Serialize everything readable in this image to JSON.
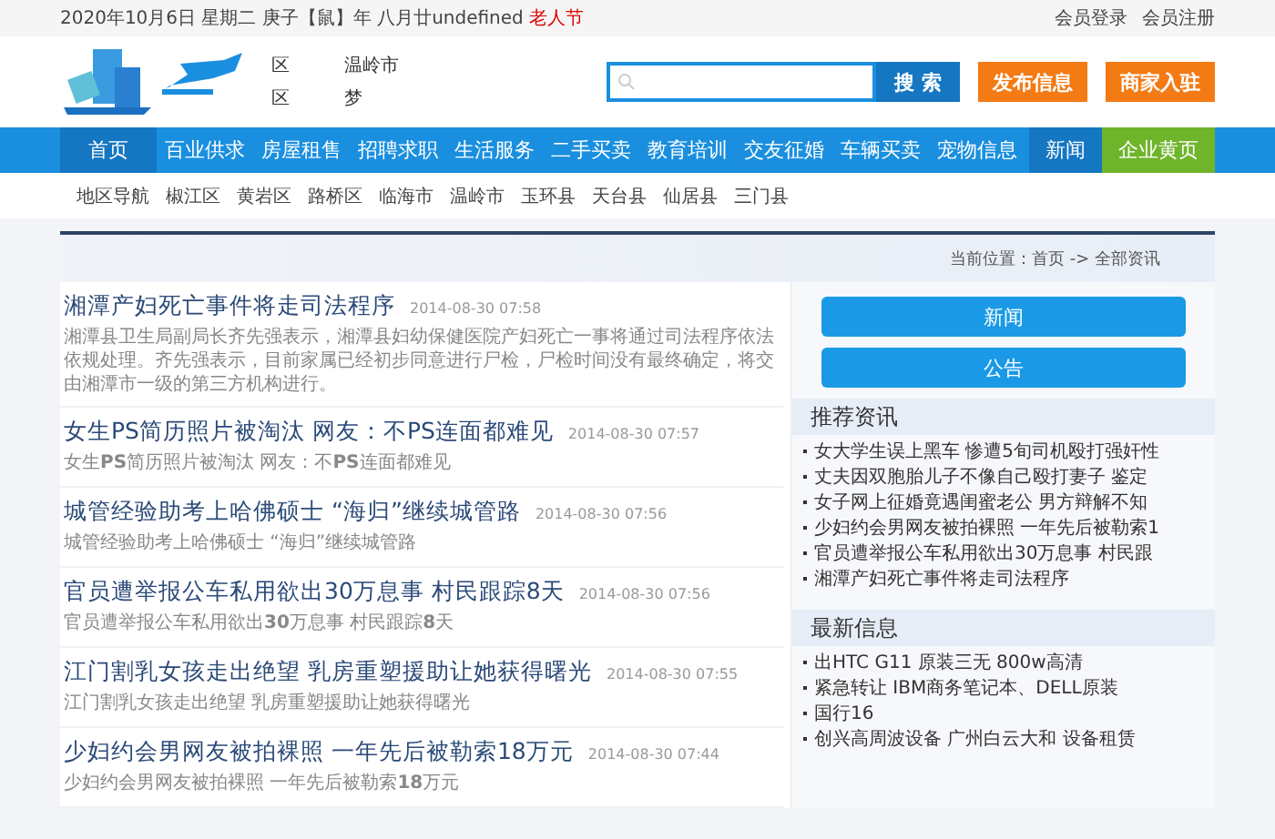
{
  "top_bar": {
    "date_text": "2020年10月6日 星期二 庚子【鼠】年 八月廿undefined",
    "festival": "老人节",
    "links": [
      "会员登录",
      "会员注册"
    ]
  },
  "header": {
    "logo_texts": [
      "区",
      "温岭市",
      "区",
      "梦"
    ],
    "search": {
      "button": "搜 索"
    },
    "actions": [
      "发布信息",
      "商家入驻"
    ]
  },
  "nav": {
    "items": [
      {
        "label": "首页",
        "selected": true
      },
      {
        "label": "百业供求",
        "selected": false
      },
      {
        "label": "房屋租售",
        "selected": false
      },
      {
        "label": "招聘求职",
        "selected": false
      },
      {
        "label": "生活服务",
        "selected": false
      },
      {
        "label": "二手买卖",
        "selected": false
      },
      {
        "label": "教育培训",
        "selected": false
      },
      {
        "label": "交友征婚",
        "selected": false
      },
      {
        "label": "车辆买卖",
        "selected": false
      },
      {
        "label": "宠物信息",
        "selected": false
      }
    ],
    "right_items": [
      {
        "label": "新闻",
        "kind": "news"
      },
      {
        "label": "企业黄页",
        "kind": "yellow"
      }
    ]
  },
  "region_nav": [
    "地区导航",
    "椒江区",
    "黄岩区",
    "路桥区",
    "临海市",
    "温岭市",
    "玉环县",
    "天台县",
    "仙居县",
    "三门县"
  ],
  "breadcrumb": "当前位置：首页 -> 全部资讯",
  "articles": [
    {
      "title": "湘潭产妇死亡事件将走司法程序",
      "time": "2014-08-30 07:58",
      "summary": "湘潭县卫生局副局长齐先强表示，湘潭县妇幼保健医院产妇死亡一事将通过司法程序依法依规处理。齐先强表示，目前家属已经初步同意进行尸检，尸检时间没有最终确定，将交由湘潭市一级的第三方机构进行。"
    },
    {
      "title": "女生PS简历照片被淘汰 网友：不PS连面都难见",
      "time": "2014-08-30 07:57",
      "summary": "女生**PS**简历照片被淘汰 网友：不**PS**连面都难见"
    },
    {
      "title": "城管经验助考上哈佛硕士 “海归”继续城管路",
      "time": "2014-08-30 07:56",
      "summary": "城管经验助考上哈佛硕士 “海归”继续城管路"
    },
    {
      "title": "官员遭举报公车私用欲出30万息事 村民跟踪8天",
      "time": "2014-08-30 07:56",
      "summary": "官员遭举报公车私用欲出**30**万息事 村民跟踪**8**天"
    },
    {
      "title": "江门割乳女孩走出绝望 乳房重塑援助让她获得曙光",
      "time": "2014-08-30 07:55",
      "summary": "江门割乳女孩走出绝望 乳房重塑援助让她获得曙光"
    },
    {
      "title": "少妇约会男网友被拍裸照 一年先后被勒索18万元",
      "time": "2014-08-30 07:44",
      "summary": "少妇约会男网友被拍裸照 一年先后被勒索**18**万元"
    }
  ],
  "sidebar": {
    "buttons": [
      "新闻",
      "公告"
    ],
    "sections": [
      {
        "title": "推荐资讯",
        "items": [
          "女大学生误上黑车 惨遭5旬司机殴打强奸性",
          "丈夫因双胞胎儿子不像自己殴打妻子 鉴定",
          "女子网上征婚竟遇闺蜜老公 男方辩解不知",
          "少妇约会男网友被拍裸照 一年先后被勒索1",
          "官员遭举报公车私用欲出30万息事 村民跟",
          "湘潭产妇死亡事件将走司法程序"
        ]
      },
      {
        "title": "最新信息",
        "items": [
          "出HTC G11 原装三无 800w高清",
          "紧急转让 IBM商务笔记本、DELL原装",
          "国行16",
          "创兴高周波设备 广州白云大和 设备租赁"
        ]
      }
    ]
  }
}
